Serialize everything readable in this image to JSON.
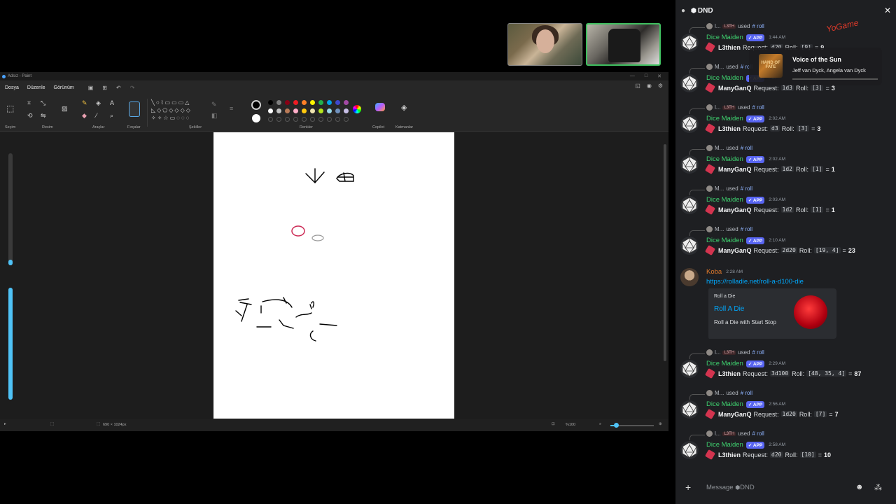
{
  "paint": {
    "title": "Adsız - Paint",
    "menu": [
      "Dosya",
      "Düzenle",
      "Görünüm"
    ],
    "groups": {
      "selection": "Seçim",
      "image": "Resim",
      "tools": "Araçlar",
      "brushes": "Fırçalar",
      "shapes": "Şekiller",
      "colors": "Renkler",
      "copilot": "Copilot",
      "layers": "Katmanlar"
    },
    "status": {
      "size": "690 × 1024px",
      "zoom": "%100"
    },
    "colors": [
      "#000000",
      "#7f7f7f",
      "#880015",
      "#ed1c24",
      "#ff7f27",
      "#fff200",
      "#22b14c",
      "#00a2e8",
      "#3f48cc",
      "#a349a4",
      "#ffffff",
      "#c3c3c3",
      "#b97a57",
      "#ffaec9",
      "#ffc90e",
      "#efe4b0",
      "#b5e61d",
      "#99d9ea",
      "#7092be",
      "#c8bfe7"
    ]
  },
  "discord": {
    "channel": "DND",
    "close": "✕",
    "message_placeholder": "Message ",
    "message_channel": "DND",
    "messages": [
      {
        "reply_user": "l...",
        "reply_tag": "L3TH",
        "used": "used",
        "cmd": "roll",
        "author": "Dice Maiden",
        "app": "APP",
        "time": "1:44 AM",
        "user": "L3thien",
        "request": "d20",
        "roll": "[9]",
        "total": "9"
      },
      {
        "reply_user": "M...",
        "reply_tag": "",
        "used": "used",
        "cmd": "roll",
        "author": "Dice Maiden",
        "app": "APP",
        "time": "AM",
        "user": "ManyGanQ",
        "request": "1d3",
        "roll": "[3]",
        "total": "3"
      },
      {
        "reply_user": "l...",
        "reply_tag": "L3TH",
        "used": "used",
        "cmd": "roll",
        "author": "Dice Maiden",
        "app": "APP",
        "time": "2:02 AM",
        "user": "L3thien",
        "request": "d3",
        "roll": "[3]",
        "total": "3"
      },
      {
        "reply_user": "M...",
        "reply_tag": "",
        "used": "used",
        "cmd": "roll",
        "author": "Dice Maiden",
        "app": "APP",
        "time": "2:02 AM",
        "user": "ManyGanQ",
        "request": "1d2",
        "roll": "[1]",
        "total": "1"
      },
      {
        "reply_user": "M...",
        "reply_tag": "",
        "used": "used",
        "cmd": "roll",
        "author": "Dice Maiden",
        "app": "APP",
        "time": "2:03 AM",
        "user": "ManyGanQ",
        "request": "1d2",
        "roll": "[1]",
        "total": "1"
      },
      {
        "reply_user": "M...",
        "reply_tag": "",
        "used": "used",
        "cmd": "roll",
        "author": "Dice Maiden",
        "app": "APP",
        "time": "2:10 AM",
        "user": "ManyGanQ",
        "request": "2d20",
        "roll": "[19, 4]",
        "total": "23"
      }
    ],
    "koba": {
      "author": "Koba",
      "time": "2:28 AM",
      "link": "https://rolladie.net/roll-a-d100-die",
      "embed_site": "Roll a Die",
      "embed_title": "Roll A Die",
      "embed_desc": "Roll a Die with Start Stop"
    },
    "messages2": [
      {
        "reply_user": "l...",
        "reply_tag": "L3TH",
        "used": "used",
        "cmd": "roll",
        "author": "Dice Maiden",
        "app": "APP",
        "time": "2:29 AM",
        "user": "L3thien",
        "request": "3d100",
        "roll": "[48, 35, 4]",
        "total": "87"
      },
      {
        "reply_user": "M...",
        "reply_tag": "",
        "used": "used",
        "cmd": "roll",
        "author": "Dice Maiden",
        "app": "APP",
        "time": "2:56 AM",
        "user": "ManyGanQ",
        "request": "1d20",
        "roll": "[7]",
        "total": "7"
      },
      {
        "reply_user": "l...",
        "reply_tag": "L3TH",
        "used": "used",
        "cmd": "roll",
        "author": "Dice Maiden",
        "app": "APP",
        "time": "2:58 AM",
        "user": "L3thien",
        "request": "d20",
        "roll": "[10]",
        "total": "10"
      }
    ],
    "labels": {
      "request": "Request:",
      "roll": "Roll:",
      "eq": "="
    }
  },
  "music": {
    "title": "Voice of the Sun",
    "artist": "Jeff van Dyck, Angela van Dyck",
    "album_text": "HAND OF FATE"
  },
  "overlay": {
    "logo_text": "YoGame"
  }
}
